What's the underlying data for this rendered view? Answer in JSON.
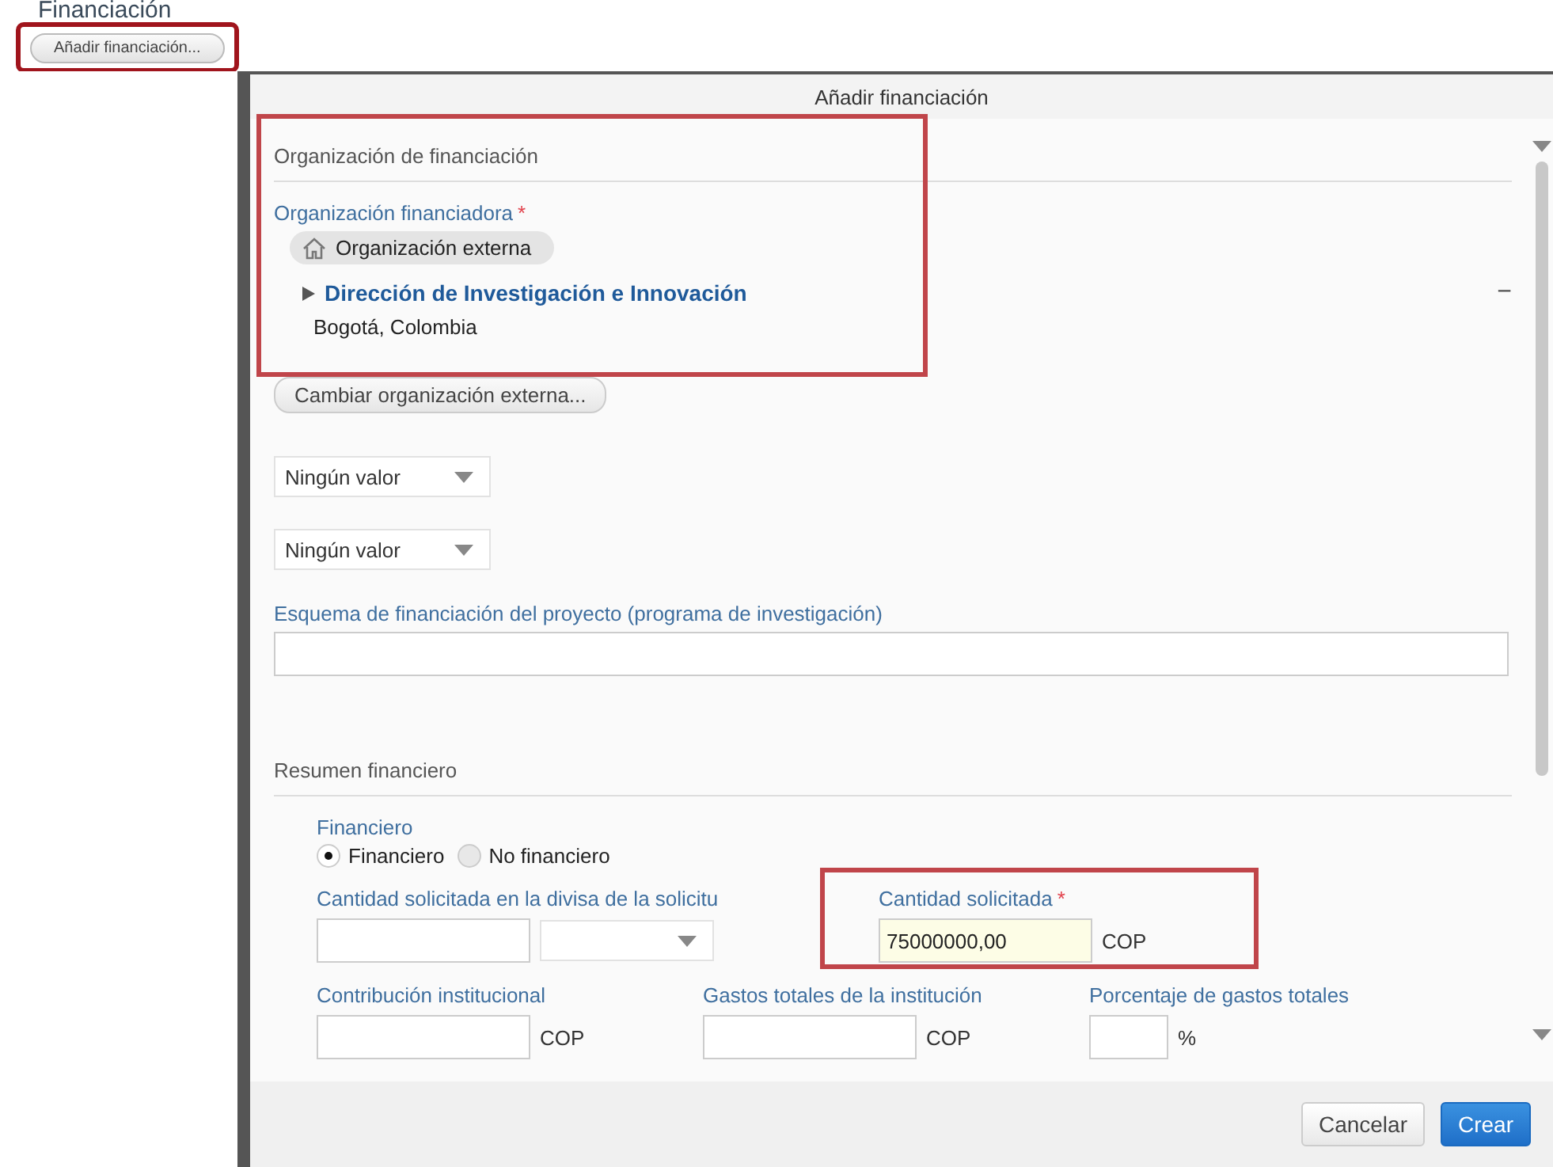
{
  "page": {
    "heading": "Financiación",
    "add_button": "Añadir financiación..."
  },
  "dialog": {
    "title": "Añadir financiación",
    "funding_org": {
      "section_title": "Organización de financiación",
      "label": "Organización financiadora",
      "required_mark": "*",
      "type_chip": "Organización externa",
      "organization": {
        "name": "Dirección de Investigación e Innovación",
        "location": "Bogotá, Colombia",
        "expanded": false
      },
      "collapse": "−",
      "change_button": "Cambiar organización externa..."
    },
    "dropdowns": [
      {
        "value": "Ningún valor"
      },
      {
        "value": "Ningún valor"
      }
    ],
    "scheme": {
      "label": "Esquema de financiación del proyecto (programa de investigación)"
    },
    "summary": {
      "section_title": "Resumen financiero",
      "type_label": "Financiero",
      "options": [
        {
          "label": "Financiero",
          "selected": true
        },
        {
          "label": "No financiero",
          "selected": false
        }
      ],
      "rows": [
        [
          {
            "kind": "currency_select",
            "label": "Cantidad solicitada en la divisa de la solicitu"
          },
          {
            "kind": "amount",
            "label": "Cantidad solicitada",
            "required_mark": "*",
            "value": "75000000,00",
            "unit": "COP",
            "highlighted": true
          }
        ],
        [
          {
            "kind": "amount",
            "label": "Contribución institucional",
            "unit": "COP",
            "highlighted": false
          },
          {
            "kind": "amount",
            "label": "Gastos totales de la institución",
            "unit": "COP",
            "highlighted": false
          },
          {
            "kind": "percent",
            "label": "Porcentaje de gastos totales",
            "unit": "%"
          }
        ]
      ]
    },
    "buttons": [
      {
        "label": "Cancelar",
        "primary": false
      },
      {
        "label": "Crear",
        "primary": true
      }
    ]
  }
}
